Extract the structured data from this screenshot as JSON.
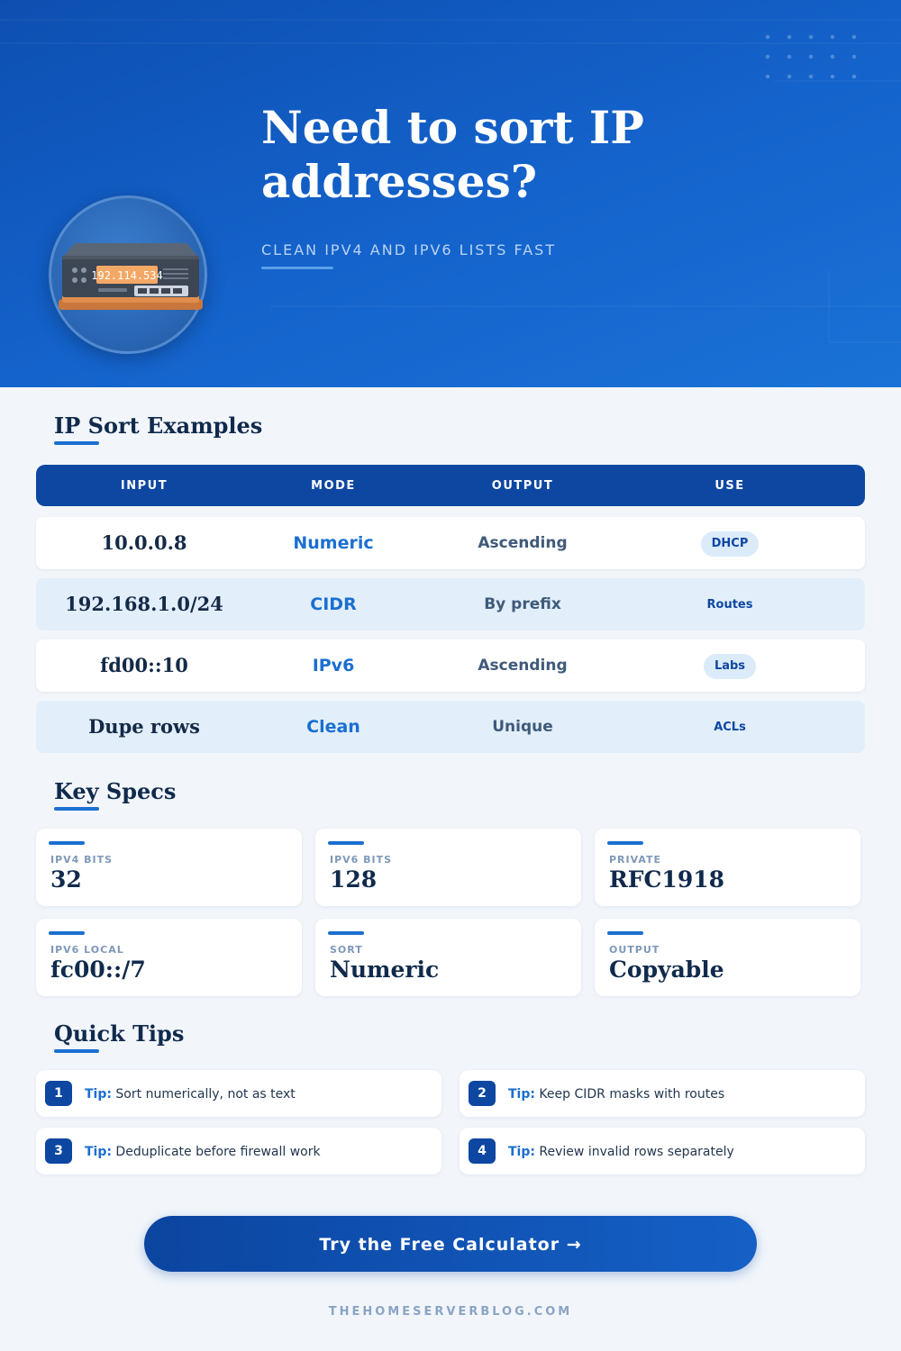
{
  "hero": {
    "title": "Need to sort IP addresses?",
    "subtitle": "CLEAN IPV4 AND IPV6 LISTS FAST",
    "device_display": "192.114.534"
  },
  "examples": {
    "heading": "IP Sort Examples",
    "columns": [
      "INPUT",
      "MODE",
      "OUTPUT",
      "USE"
    ],
    "rows": [
      {
        "input": "10.0.0.8",
        "mode": "Numeric",
        "output": "Ascending",
        "use": "DHCP"
      },
      {
        "input": "192.168.1.0/24",
        "mode": "CIDR",
        "output": "By prefix",
        "use": "Routes"
      },
      {
        "input": "fd00::10",
        "mode": "IPv6",
        "output": "Ascending",
        "use": "Labs"
      },
      {
        "input": "Dupe rows",
        "mode": "Clean",
        "output": "Unique",
        "use": "ACLs"
      }
    ]
  },
  "specs": {
    "heading": "Key Specs",
    "items": [
      {
        "label": "IPV4 BITS",
        "value": "32"
      },
      {
        "label": "IPV6 BITS",
        "value": "128"
      },
      {
        "label": "PRIVATE",
        "value": "RFC1918"
      },
      {
        "label": "IPV6 LOCAL",
        "value": "fc00::/7"
      },
      {
        "label": "SORT",
        "value": "Numeric"
      },
      {
        "label": "OUTPUT",
        "value": "Copyable"
      }
    ]
  },
  "tips": {
    "heading": "Quick Tips",
    "prefix": "Tip:",
    "items": [
      {
        "num": "1",
        "text": "Sort numerically, not as text"
      },
      {
        "num": "2",
        "text": "Keep CIDR masks with routes"
      },
      {
        "num": "3",
        "text": "Deduplicate before firewall work"
      },
      {
        "num": "4",
        "text": "Review invalid rows separately"
      }
    ]
  },
  "cta": {
    "label": "Try the Free Calculator →"
  },
  "footer": {
    "site": "THEHOMESERVERBLOG.COM"
  },
  "colors": {
    "primary": "#0d47a1",
    "accent": "#1b6fd0",
    "display": "#f4a866"
  }
}
